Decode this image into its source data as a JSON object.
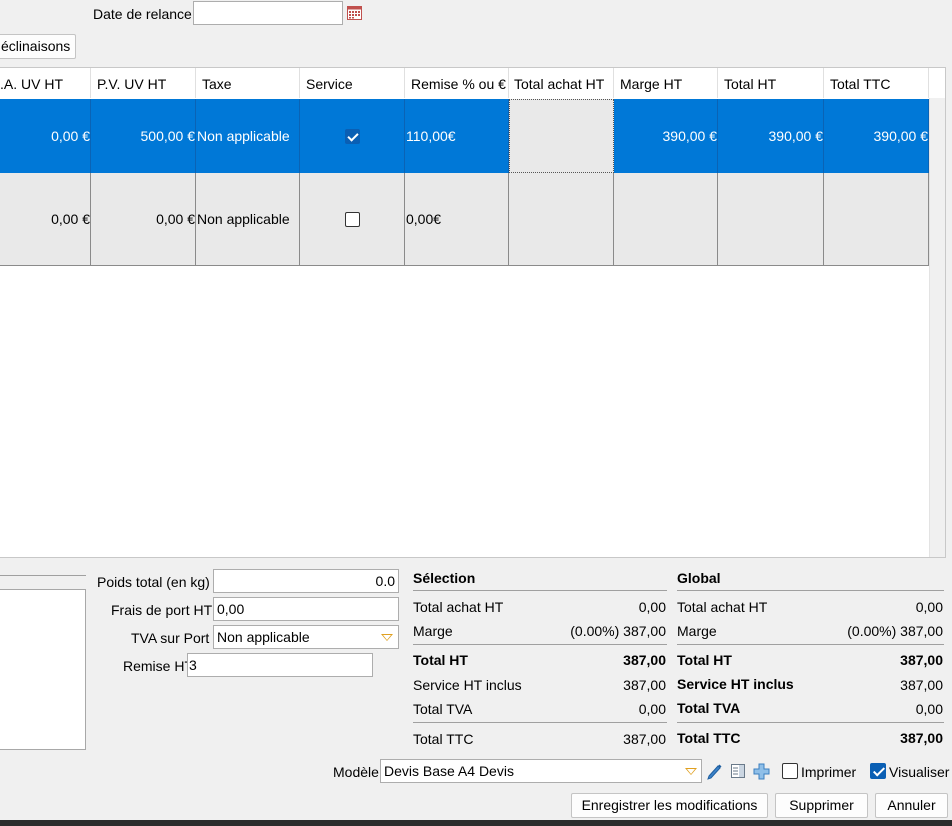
{
  "header": {
    "date_relance_label": "Date de relance",
    "date_relance_value": "",
    "declinaisons_button": "éclinaisons"
  },
  "table": {
    "columns": [
      ".A. UV HT",
      "P.V. UV HT",
      "Taxe",
      "Service",
      "Remise % ou €",
      "Total achat HT",
      "Marge HT",
      "Total HT",
      "Total TTC"
    ],
    "rows": [
      {
        "pa": "0,00 €",
        "pv": "500,00 €",
        "taxe": "Non applicable",
        "service": true,
        "remise": "110,00€",
        "total_achat": "",
        "marge": "390,00 €",
        "total_ht": "390,00 €",
        "total_ttc": "390,00 €"
      },
      {
        "pa": "0,00 €",
        "pv": "0,00 €",
        "taxe": "Non applicable",
        "service": false,
        "remise": "0,00€",
        "total_achat": "",
        "marge": "",
        "total_ht": "",
        "total_ttc": ""
      }
    ]
  },
  "footer_form": {
    "poids_label": "Poids total (en kg)",
    "poids_value": "0.0",
    "frais_label": "Frais de port HT",
    "frais_value": "0,00",
    "tva_label": "TVA sur Port",
    "tva_value": "Non applicable",
    "remise_label": "Remise HT",
    "remise_value": "3"
  },
  "selection": {
    "title": "Sélection",
    "total_achat_label": "Total achat HT",
    "total_achat_value": "0,00",
    "marge_label": "Marge",
    "marge_value": "(0.00%) 387,00",
    "total_ht_label": "Total HT",
    "total_ht_value": "387,00",
    "service_label": "Service HT inclus",
    "service_value": "387,00",
    "tva_label": "Total TVA",
    "tva_value": "0,00",
    "ttc_label": "Total TTC",
    "ttc_value": "387,00"
  },
  "global": {
    "title": "Global",
    "total_achat_label": "Total achat HT",
    "total_achat_value": "0,00",
    "marge_label": "Marge",
    "marge_value": "(0.00%) 387,00",
    "total_ht_label": "Total HT",
    "total_ht_value": "387,00",
    "service_label": "Service HT inclus",
    "service_value": "387,00",
    "tva_label": "Total TVA",
    "tva_value": "0,00",
    "ttc_label": "Total TTC",
    "ttc_value": "387,00"
  },
  "bottom": {
    "modele_label": "Modèle",
    "modele_value": "Devis Base A4 Devis",
    "imprimer_label": "Imprimer",
    "imprimer_checked": false,
    "visualiser_label": "Visualiser",
    "visualiser_checked": true,
    "save_button": "Enregistrer les modifications",
    "delete_button": "Supprimer",
    "cancel_button": "Annuler"
  },
  "colors": {
    "selection": "#0078d7",
    "accent_icon": "#3b82c8"
  }
}
